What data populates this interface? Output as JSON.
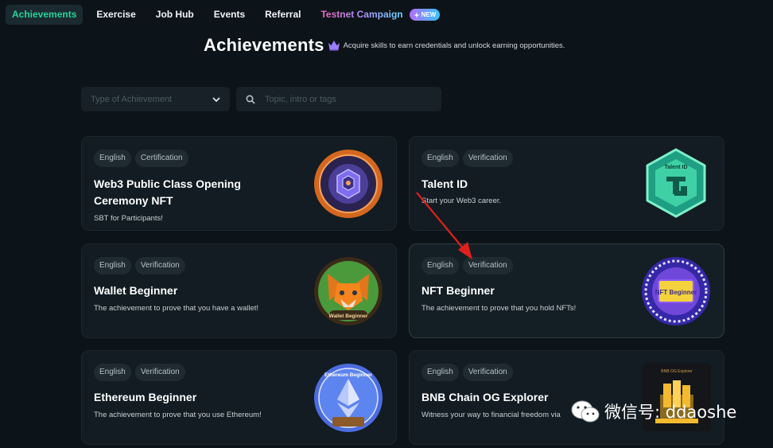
{
  "nav": {
    "items": [
      {
        "label": "Achievements",
        "active": true
      },
      {
        "label": "Exercise"
      },
      {
        "label": "Job Hub"
      },
      {
        "label": "Events"
      },
      {
        "label": "Referral"
      }
    ],
    "campaign_label": "Testnet Campaign",
    "new_badge": "NEW"
  },
  "header": {
    "title": "Achievements",
    "subtitle": "Acquire skills to earn credentials and unlock earning opportunities."
  },
  "filters": {
    "type_placeholder": "Type of Achievement",
    "search_placeholder": "Topic, intro or tags"
  },
  "cards": [
    {
      "tags": [
        "English",
        "Certification"
      ],
      "title": "Web3 Public Class Opening Ceremony NFT",
      "desc": "SBT for Participants!",
      "badge_icon": "opening-ceremony-badge-icon"
    },
    {
      "tags": [
        "English",
        "Verification"
      ],
      "title": "Talent ID",
      "desc": "Start your Web3 career.",
      "badge_icon": "talent-id-badge-icon",
      "badge_text": "Talent ID"
    },
    {
      "tags": [
        "English",
        "Verification"
      ],
      "title": "Wallet Beginner",
      "desc": "The achievement to prove that you have a wallet!",
      "badge_icon": "metamask-fox-badge-icon",
      "badge_text": "Wallet Beginner"
    },
    {
      "tags": [
        "English",
        "Verification"
      ],
      "title": "NFT Beginner",
      "desc": "The achievement to prove that you hold NFTs!",
      "badge_icon": "nft-beginner-badge-icon",
      "badge_text": "NFT Beginner"
    },
    {
      "tags": [
        "English",
        "Verification"
      ],
      "title": "Ethereum Beginner",
      "desc": "The achievement to prove that you use Ethereum!",
      "badge_icon": "ethereum-badge-icon",
      "badge_text": "Ethereum Beginner"
    },
    {
      "tags": [
        "English",
        "Verification"
      ],
      "title": "BNB Chain OG Explorer",
      "desc": "Witness your way to financial freedom via",
      "badge_icon": "bnb-chain-badge-icon",
      "badge_text": "BNB OG Explorer"
    }
  ],
  "watermark": {
    "text": "微信号: ddaoshe"
  },
  "colors": {
    "background": "#0d1419",
    "card": "#121c22",
    "accent": "#26d39a",
    "annotation_arrow": "#e0201c"
  }
}
